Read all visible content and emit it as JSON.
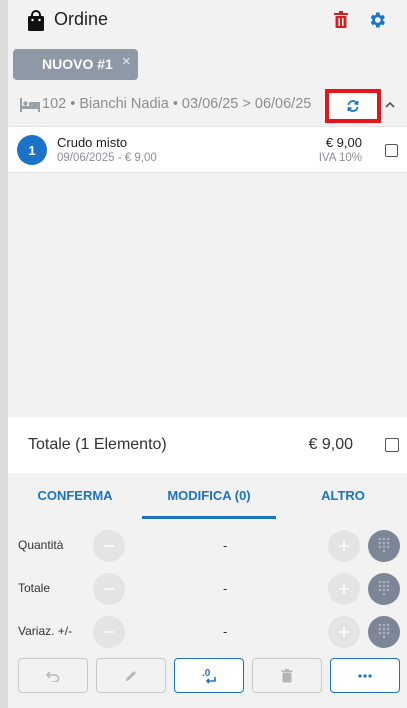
{
  "header": {
    "title": "Ordine",
    "icons": [
      "shopping-bag-icon",
      "trash-icon",
      "gear-icon"
    ]
  },
  "tab": {
    "label": "NUOVO #1",
    "close": "×"
  },
  "booking": {
    "summary": "102 • Bianchi Nadia • 03/06/25 > 06/06/25"
  },
  "items": [
    {
      "number": "1",
      "name": "Crudo misto",
      "date_price": "09/06/2025 - € 9,00",
      "price": "€ 9,00",
      "vat": "IVA 10%"
    }
  ],
  "total": {
    "label": "Totale (1 Elemento)",
    "value": "€ 9,00"
  },
  "actions": {
    "confirm": "CONFERMA",
    "modify": "MODIFICA (0)",
    "more": "ALTRO"
  },
  "modifiers": [
    {
      "label": "Quantità",
      "value": "-"
    },
    {
      "label": "Totale",
      "value": "-"
    },
    {
      "label": "Variaz. +/-",
      "value": "-"
    }
  ],
  "toolbar": {
    "decimal_label": ".0",
    "more_label": "···"
  },
  "colors": {
    "accent": "#1a73c8",
    "danger": "#e02020",
    "highlight_box": "#e8141a",
    "chip": "#8f98a6",
    "keypad": "#7d8697"
  }
}
